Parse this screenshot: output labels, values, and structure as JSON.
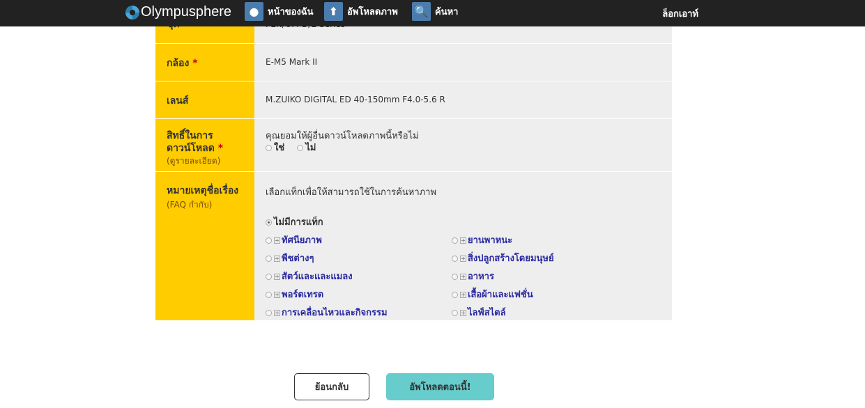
{
  "nav": {
    "logo": "Olympusphere",
    "items": [
      {
        "label": "หน้าของฉัน",
        "icon": "profile-icon"
      },
      {
        "label": "อัพโหลดภาพ",
        "icon": "upload-icon"
      },
      {
        "label": "ค้นหา",
        "icon": "search-icon"
      }
    ],
    "logout": "ล็อกเอาท์"
  },
  "form": {
    "series": {
      "label": "ชุด",
      "value": "PEN/OM-D/E-Series"
    },
    "camera": {
      "label": "กล้อง",
      "required": "*",
      "value": "E-M5 Mark II"
    },
    "lens": {
      "label": "เลนส์",
      "value": "M.ZUIKO DIGITAL ED 40-150mm F4.0-5.6 R"
    },
    "download": {
      "label1": "สิทธิ์ในการ",
      "label2": "ดาวน์โหลด",
      "required": "*",
      "detail": "(ดูรายละเอียด)",
      "question": "คุณยอมให้ผู้อื่นดาวน์โหลดภาพนี้หรือไม่",
      "yes": "ใช่",
      "no": "ไม่"
    },
    "tags": {
      "label": "หมายเหตุชื่อเรื่อง",
      "faq": "(FAQ กำกับ)",
      "hint": "เลือกแท็กเพื่อให้สามารถใช้ในการค้นหาภาพ",
      "none": "ไม่มีการแท็ก",
      "none_selected": true,
      "items": [
        "ทัศนียภาพ",
        "ยานพาหนะ",
        "พืชต่างๆ",
        "สิ่งปลูกสร้างโดยมนุษย์",
        "สัตว์และและแมลง",
        "อาหาร",
        "พอร์ตเทรต",
        "เสื้อผ้าและแฟชั่น",
        "การเคลื่อนไหวและกิจกรรม",
        "ไลฟ์สไตล์"
      ]
    }
  },
  "buttons": {
    "back": "ย้อนกลับ",
    "upload": "อัพโหลดตอนนี้!"
  },
  "colors": {
    "label_bg": "#ffcc00",
    "upload_button": "#66cccc",
    "nav_bg": "#222222",
    "tag_text": "#2a2aa0"
  }
}
